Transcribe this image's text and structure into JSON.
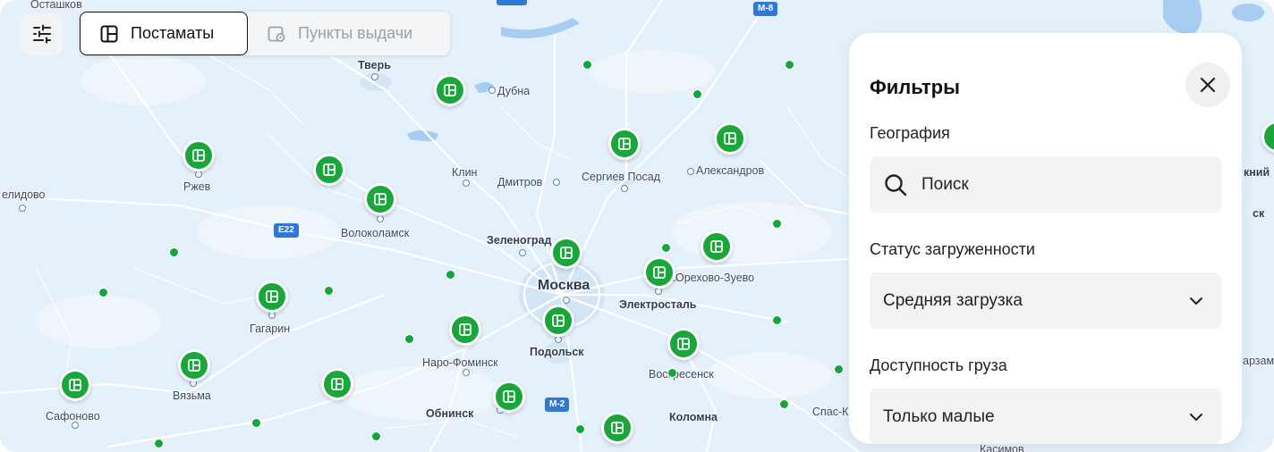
{
  "toolbar": {
    "filter_icon": "sliders-icon",
    "tabs": [
      {
        "label": "Постаматы",
        "icon": "locker-icon",
        "active": true
      },
      {
        "label": "Пункты выдачи",
        "icon": "pickup-point-icon",
        "active": false
      }
    ]
  },
  "filters": {
    "title": "Фильтры",
    "close_icon": "close-icon",
    "geography": {
      "label": "География",
      "placeholder": "Поиск"
    },
    "load_status": {
      "label": "Статус загруженности",
      "value": "Средняя загрузка"
    },
    "cargo": {
      "label": "Доступность груза",
      "value": "Только малые"
    }
  },
  "map": {
    "colors": {
      "land": "#e4f0fa",
      "water": "#a9cdf0",
      "pin": "#1aa63b"
    },
    "cities": [
      {
        "name": "Осташков"
      },
      {
        "name": "Тверь"
      },
      {
        "name": "Дубна"
      },
      {
        "name": "елидово"
      },
      {
        "name": "Ржев"
      },
      {
        "name": "Клин"
      },
      {
        "name": "Дмитров"
      },
      {
        "name": "Сергиев Посад"
      },
      {
        "name": "Александров"
      },
      {
        "name": "Волоколамск"
      },
      {
        "name": "Зеленоград"
      },
      {
        "name": "Москва"
      },
      {
        "name": "Орехово-Зуево"
      },
      {
        "name": "Электросталь"
      },
      {
        "name": "Гагарин"
      },
      {
        "name": "Наро-Фоминск"
      },
      {
        "name": "Подольск"
      },
      {
        "name": "Воскресенск"
      },
      {
        "name": "Вязьма"
      },
      {
        "name": "Сафоново"
      },
      {
        "name": "Обнинск"
      },
      {
        "name": "Коломна"
      },
      {
        "name": "Спас-К"
      },
      {
        "name": "кний"
      },
      {
        "name": "ск"
      },
      {
        "name": "арзам"
      },
      {
        "name": "Касимов"
      }
    ],
    "road_shields": [
      {
        "label": "M-8"
      },
      {
        "label": "E22"
      },
      {
        "label": "M-2"
      }
    ]
  }
}
